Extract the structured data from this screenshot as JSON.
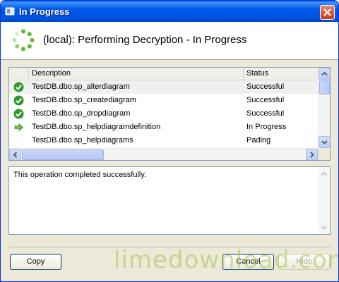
{
  "window": {
    "title": "In Progress"
  },
  "header": {
    "text": "(local): Performing Decryption - In Progress"
  },
  "list": {
    "columns": [
      "Description",
      "Status"
    ],
    "rows": [
      {
        "description": "TestDB.dbo.sp_alterdiagram",
        "status": "Successful",
        "icon": "check-icon"
      },
      {
        "description": "TestDB.dbo.sp_creatediagram",
        "status": "Successful",
        "icon": "check-icon"
      },
      {
        "description": "TestDB.dbo.sp_dropdiagram",
        "status": "Successful",
        "icon": "check-icon"
      },
      {
        "description": "TestDB.dbo.sp_helpdiagramdefinition",
        "status": "In Progress",
        "icon": "arrow-right-icon"
      },
      {
        "description": "TestDB.dbo.sp_helpdiagrams",
        "status": "Pading",
        "icon": ""
      }
    ]
  },
  "message": {
    "text": "This operation completed successfully."
  },
  "buttons": {
    "copy": "Copy",
    "cancel": "Cancel",
    "hide": "Hide"
  },
  "watermark": "limedownload.com",
  "colors": {
    "titlebar": "#0054e3",
    "success": "#2e9a2e",
    "progress": "#6cc04a"
  }
}
